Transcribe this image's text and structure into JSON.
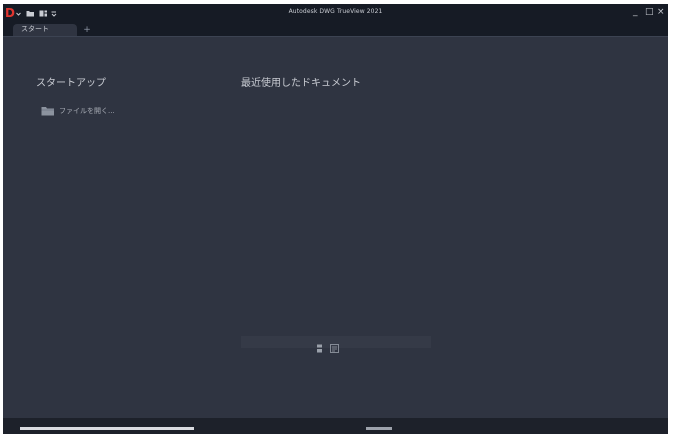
{
  "app": {
    "title": "Autodesk DWG TrueView 2021",
    "logo_text": "D"
  },
  "quick_access": {
    "dropdown_icon": "chevron-down-icon",
    "open_icon": "folder-open-icon",
    "layout_icon": "layout-icon",
    "menu_icon": "chevron-down-icon"
  },
  "window_controls": {
    "minimize": "_",
    "maximize": "□",
    "close": "×"
  },
  "tabs": {
    "start_label": "スタート",
    "add_label": "+"
  },
  "startup": {
    "title": "スタートアップ",
    "open_file_label": "ファイルを開く..."
  },
  "recent": {
    "title": "最近使用したドキュメント"
  },
  "colors": {
    "background": "#2f3441",
    "titlebar": "#161b25",
    "accent_logo": "#e0352f"
  }
}
